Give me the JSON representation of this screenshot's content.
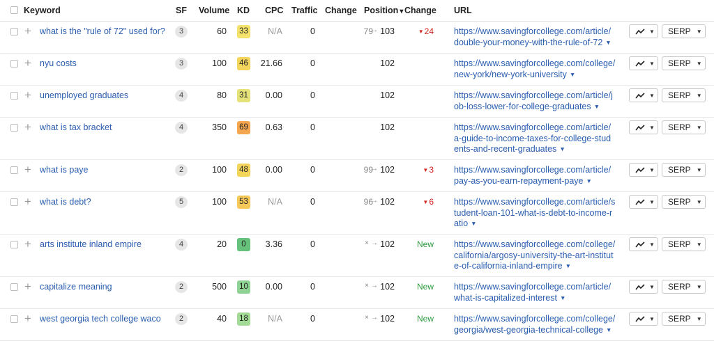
{
  "header": {
    "keyword": "Keyword",
    "sf": "SF",
    "volume": "Volume",
    "kd": "KD",
    "cpc": "CPC",
    "traffic": "Traffic",
    "change": "Change",
    "position": "Position",
    "position_sort_icon": "▾",
    "change2": "Change",
    "url": "URL"
  },
  "rows": [
    {
      "keyword": "what is the \"rule of 72\" used for?",
      "sf": "3",
      "volume": "60",
      "kd": "33",
      "kd_color": "#f4e26d",
      "cpc": "N/A",
      "traffic": "0",
      "prev": "79",
      "pos": "103",
      "change": "24",
      "change_dir": "down",
      "url": "https://www.savingforcollege.com/article/double-your-money-with-the-rule-of-72"
    },
    {
      "keyword": "nyu costs",
      "sf": "3",
      "volume": "100",
      "kd": "46",
      "kd_color": "#f4d55c",
      "cpc": "21.66",
      "traffic": "0",
      "prev": "",
      "pos": "102",
      "change": "",
      "change_dir": "",
      "url": "https://www.savingforcollege.com/college/new-york/new-york-university"
    },
    {
      "keyword": "unemployed graduates",
      "sf": "4",
      "volume": "80",
      "kd": "31",
      "kd_color": "#e6e27a",
      "cpc": "0.00",
      "traffic": "0",
      "prev": "",
      "pos": "102",
      "change": "",
      "change_dir": "",
      "url": "https://www.savingforcollege.com/article/job-loss-lower-for-college-graduates"
    },
    {
      "keyword": "what is tax bracket",
      "sf": "4",
      "volume": "350",
      "kd": "69",
      "kd_color": "#f5a74f",
      "cpc": "0.63",
      "traffic": "0",
      "prev": "",
      "pos": "102",
      "change": "",
      "change_dir": "",
      "url": "https://www.savingforcollege.com/article/a-guide-to-income-taxes-for-college-students-and-recent-graduates"
    },
    {
      "keyword": "what is paye",
      "sf": "2",
      "volume": "100",
      "kd": "48",
      "kd_color": "#f4d55c",
      "cpc": "0.00",
      "traffic": "0",
      "prev": "99",
      "pos": "102",
      "change": "3",
      "change_dir": "down",
      "url": "https://www.savingforcollege.com/article/pay-as-you-earn-repayment-paye"
    },
    {
      "keyword": "what is debt?",
      "sf": "5",
      "volume": "100",
      "kd": "53",
      "kd_color": "#f4c95a",
      "cpc": "N/A",
      "traffic": "0",
      "prev": "96",
      "pos": "102",
      "change": "6",
      "change_dir": "down",
      "url": "https://www.savingforcollege.com/article/student-loan-101-what-is-debt-to-income-ratio"
    },
    {
      "keyword": "arts institute inland empire",
      "sf": "4",
      "volume": "20",
      "kd": "0",
      "kd_color": "#66c27a",
      "cpc": "3.36",
      "traffic": "0",
      "prev": "×",
      "pos": "102",
      "change": "New",
      "change_dir": "new",
      "url": "https://www.savingforcollege.com/college/california/argosy-university-the-art-institute-of-california-inland-empire"
    },
    {
      "keyword": "capitalize meaning",
      "sf": "2",
      "volume": "500",
      "kd": "10",
      "kd_color": "#8ed393",
      "cpc": "0.00",
      "traffic": "0",
      "prev": "×",
      "pos": "102",
      "change": "New",
      "change_dir": "new",
      "url": "https://www.savingforcollege.com/article/what-is-capitalized-interest"
    },
    {
      "keyword": "west georgia tech college waco",
      "sf": "2",
      "volume": "40",
      "kd": "18",
      "kd_color": "#a4dc97",
      "cpc": "N/A",
      "traffic": "0",
      "prev": "×",
      "pos": "102",
      "change": "New",
      "change_dir": "new",
      "url": "https://www.savingforcollege.com/college/georgia/west-georgia-technical-college"
    }
  ],
  "buttons": {
    "serp_label": "SERP"
  },
  "icons": {
    "chart": "trend-chart-icon",
    "dropdown": "caret-down-icon",
    "expand": "plus-icon",
    "position_arrow": "arrow-right-icon"
  },
  "colors": {
    "link": "#2a5db0",
    "decrease": "#d0261e",
    "new": "#2b9a3e"
  }
}
